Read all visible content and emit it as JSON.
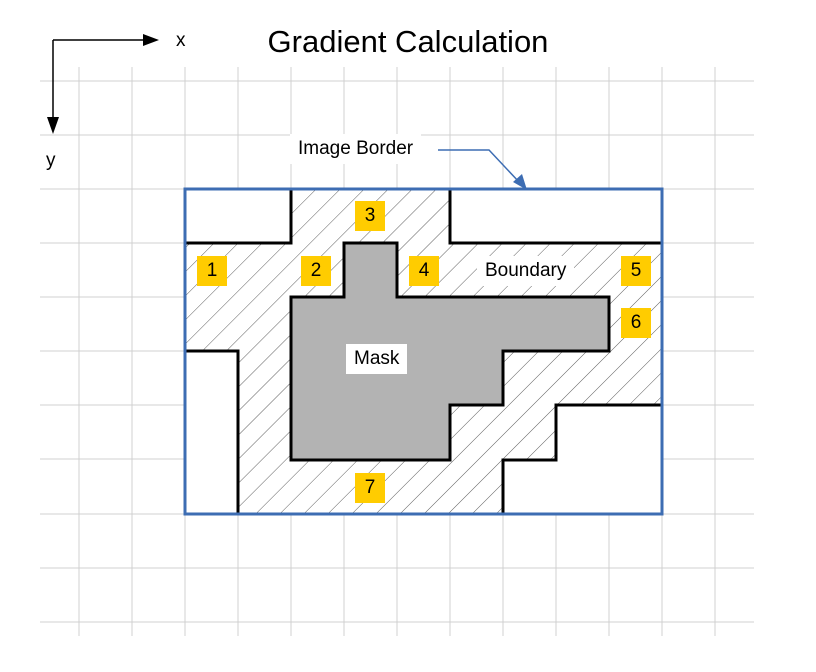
{
  "title": "Gradient Calculation",
  "axes": {
    "x_label": "x",
    "y_label": "y"
  },
  "labels": {
    "image_border": "Image Border",
    "boundary": "Boundary",
    "mask": "Mask"
  },
  "badges": [
    "1",
    "2",
    "3",
    "4",
    "5",
    "6",
    "7"
  ],
  "colors": {
    "grid": "#d0d0d0",
    "border": "#3d6db3",
    "mask_fill": "#b3b3b3",
    "hatch": "#4d4d4d",
    "badge": "#ffcc00",
    "outline": "#000000"
  }
}
